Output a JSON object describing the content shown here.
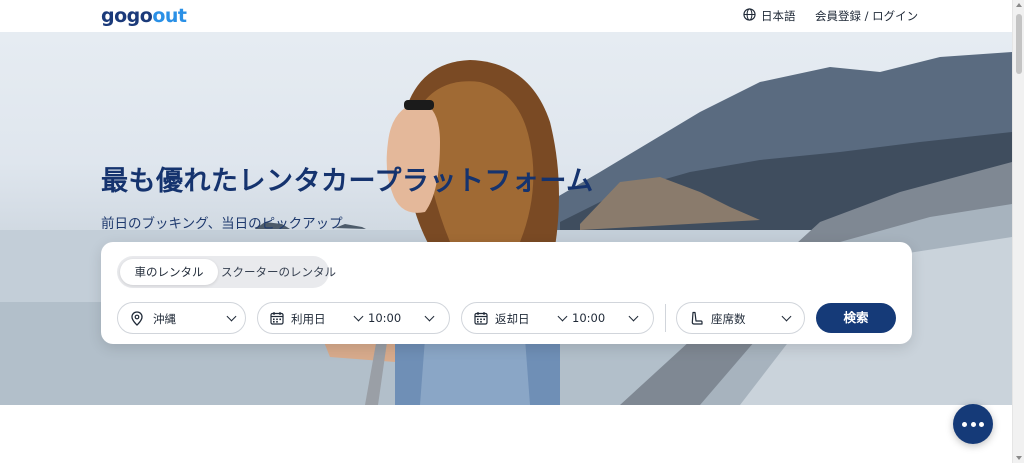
{
  "header": {
    "logo_text": "gogoout",
    "language": "日本語",
    "login": "会員登録 / ログイン"
  },
  "hero": {
    "title": "最も優れたレンタカープラットフォーム",
    "subtitle": "前日のブッキング、当日のピックアップ"
  },
  "search": {
    "tabs": [
      {
        "label": "車のレンタル",
        "active": true
      },
      {
        "label": "スクーターのレンタル",
        "active": false
      }
    ],
    "location": {
      "value": "沖縄",
      "icon": "map-pin-icon"
    },
    "pickup": {
      "date": "利用日",
      "time": "10:00",
      "icon": "calendar-icon"
    },
    "return": {
      "date": "返却日",
      "time": "10:00",
      "icon": "calendar-icon"
    },
    "seats": {
      "label": "座席数",
      "icon": "seat-icon"
    },
    "button": "検索"
  },
  "colors": {
    "brand_navy": "#153a78",
    "title_navy": "#15336e",
    "logo_blue": "#2a90e6"
  }
}
